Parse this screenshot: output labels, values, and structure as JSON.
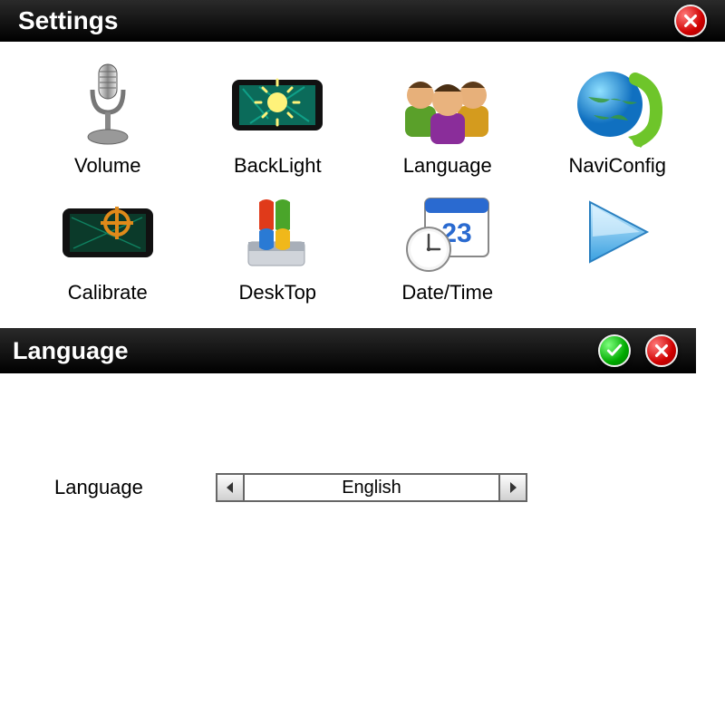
{
  "settings": {
    "title": "Settings",
    "items": [
      {
        "label": "Volume"
      },
      {
        "label": "BackLight"
      },
      {
        "label": "Language"
      },
      {
        "label": "NaviConfig"
      },
      {
        "label": "Calibrate"
      },
      {
        "label": "DeskTop"
      },
      {
        "label": "Date/Time"
      },
      {
        "label": ""
      }
    ]
  },
  "language_panel": {
    "title": "Language",
    "field_label": "Language",
    "value": "English"
  }
}
